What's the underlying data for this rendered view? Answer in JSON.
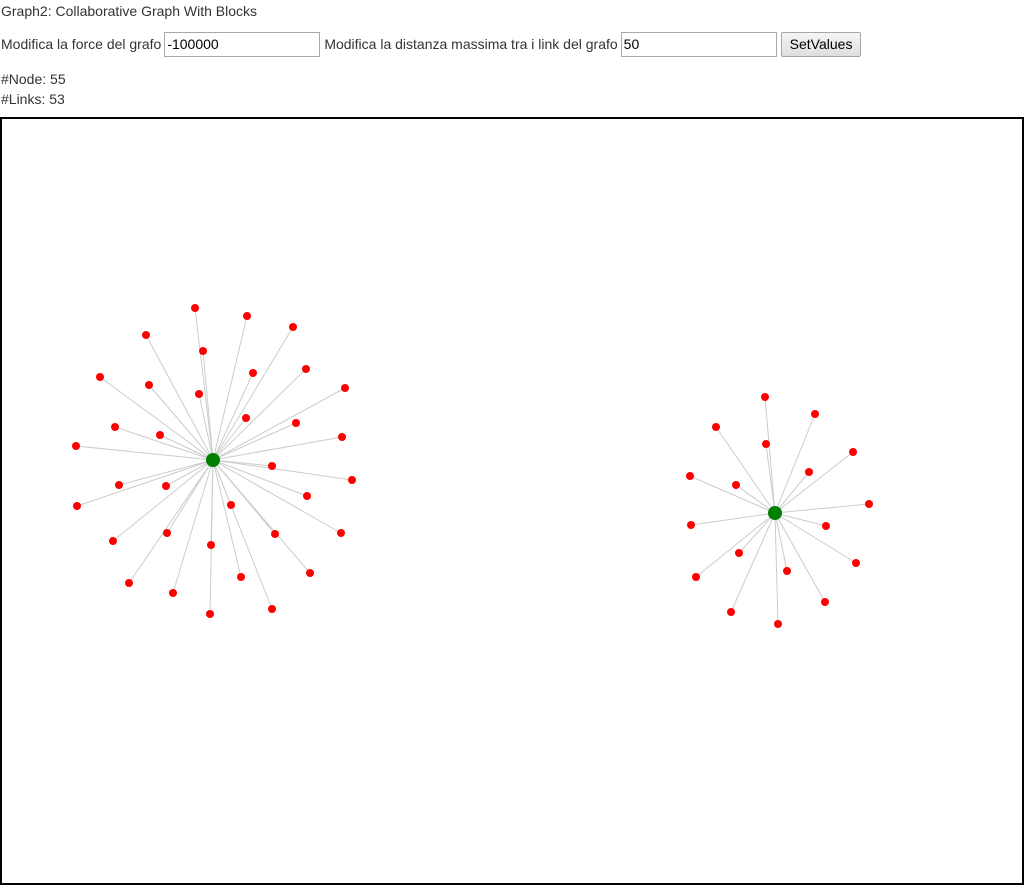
{
  "title": "Graph2: Collaborative Graph With Blocks",
  "controls": {
    "force_label": "Modifica la force del grafo",
    "force_value": "-100000",
    "distance_label": "Modifica la distanza massima tra i link del grafo",
    "distance_value": "50",
    "set_button": "SetValues"
  },
  "stats": {
    "nodes_text": "#Node: 55",
    "links_text": "#Links: 53"
  },
  "graph": {
    "node_color": "#ff0000",
    "hub_color": "#008000",
    "link_color": "#cccccc"
  }
}
